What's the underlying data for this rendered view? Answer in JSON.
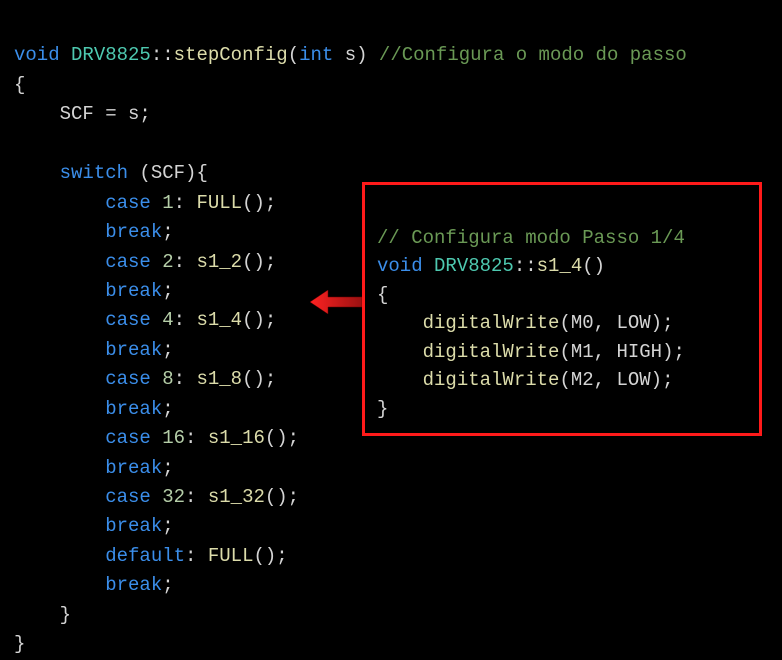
{
  "main": {
    "l1_void": "void",
    "l1_cls": "DRV8825",
    "l1_scope": "::",
    "l1_fn": "stepConfig",
    "l1_open": "(",
    "l1_int": "int",
    "l1_param": " s) ",
    "l1_cmt": "//Configura o modo do passo",
    "l2": "{",
    "l3_ind": "    ",
    "l3": "SCF = s;",
    "l5_ind": "    ",
    "l5_kw": "switch",
    "l5_rest": " (SCF){",
    "ind2": "        ",
    "case_kw": "case",
    "break_kw": "break",
    "default_kw": "default",
    "c1_num": "1",
    "c1_call": "FULL",
    "c1_paren": "();",
    "c2_num": "2",
    "c2_call": "s1_2",
    "c2_paren": "();",
    "c4_num": "4",
    "c4_call": "s1_4",
    "c4_paren": "();",
    "c8_num": "8",
    "c8_call": "s1_8",
    "c8_paren": "();",
    "c16_num": "16",
    "c16_call": "s1_16",
    "c16_paren": "();",
    "c32_num": "32",
    "c32_call": "s1_32",
    "c32_paren": "();",
    "cdef_call": "FULL",
    "cdef_paren": "();",
    "semi": ";",
    "colon_sp": ": ",
    "close_inner_ind": "    ",
    "close_inner": "}",
    "close_outer": "}"
  },
  "callout": {
    "cmt": "// Configura modo Passo 1/4",
    "void": "void",
    "cls": "DRV8825",
    "scope": "::",
    "fn": "s1_4",
    "paren": "()",
    "open": "{",
    "ind": "    ",
    "dw": "digitalWrite",
    "a1_open": "(M0, ",
    "a1_val": "LOW",
    "a1_close": ");",
    "a2_open": "(M1, ",
    "a2_val": "HIGH",
    "a2_close": ");",
    "a3_open": "(M2, ",
    "a3_val": "LOW",
    "a3_close": ");",
    "close": "}"
  }
}
